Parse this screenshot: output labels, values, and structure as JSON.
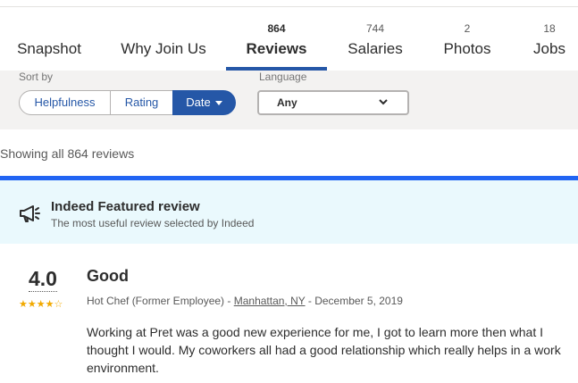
{
  "tabs": [
    {
      "label": "Snapshot",
      "count": ""
    },
    {
      "label": "Why Join Us",
      "count": ""
    },
    {
      "label": "Reviews",
      "count": "864"
    },
    {
      "label": "Salaries",
      "count": "744"
    },
    {
      "label": "Photos",
      "count": "2"
    },
    {
      "label": "Jobs",
      "count": "18"
    }
  ],
  "active_tab": "Reviews",
  "filters": {
    "sort_label": "Sort by",
    "sort_options": [
      "Helpfulness",
      "Rating",
      "Date"
    ],
    "sort_selected": "Date",
    "language_label": "Language",
    "language_value": "Any"
  },
  "showing_text": "Showing all 864 reviews",
  "featured": {
    "icon": "megaphone-icon",
    "title": "Indeed Featured review",
    "subtitle": "The most useful review selected by Indeed"
  },
  "review": {
    "rating": "4.0",
    "stars": "★★★★☆",
    "star_value": 4,
    "title": "Good",
    "author": "Hot Chef (Former Employee) - ",
    "location": "Manhattan, NY",
    "date": " - December 5, 2019",
    "body": "Working at Pret was a good new experience for me, I got to learn more then what I thought I would. My coworkers all had a good relationship which really helps in a work environment."
  },
  "colors": {
    "accent": "#2557a7",
    "featured_bg": "#eaf9fd",
    "star": "#f1a900"
  }
}
